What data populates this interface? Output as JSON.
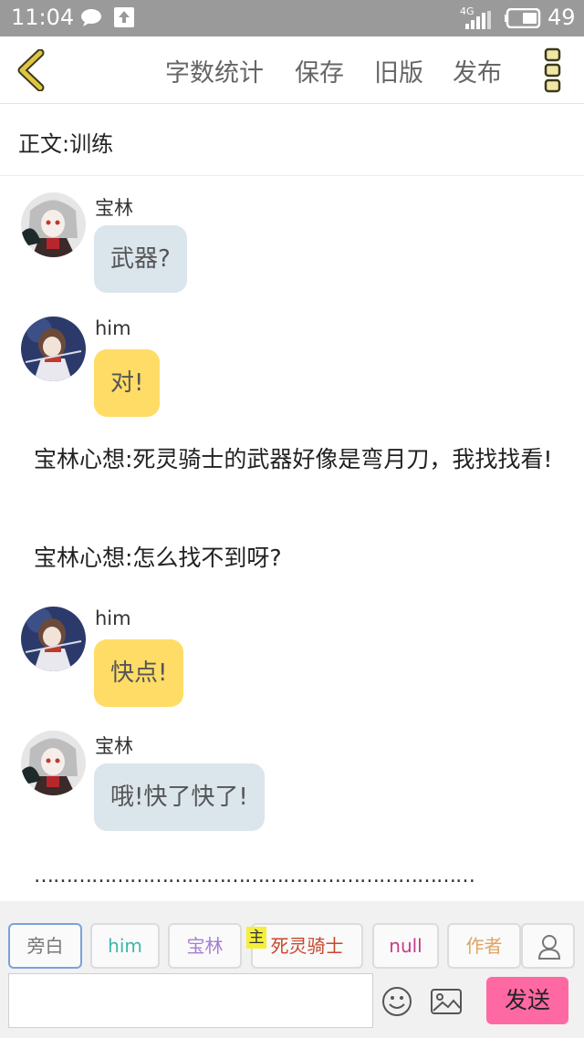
{
  "status_bar": {
    "time": "11:04",
    "network": "4G",
    "battery": "49",
    "icons": [
      "chat-icon",
      "upload-icon",
      "signal-icon",
      "battery-icon"
    ]
  },
  "toolbar": {
    "back_icon": "chevron-left-icon",
    "actions": [
      "字数统计",
      "保存",
      "旧版",
      "发布"
    ],
    "more_icon": "three-square-menu-icon",
    "accent": "#e0c542"
  },
  "title_row": {
    "text": "正文:训练"
  },
  "messages": [
    {
      "type": "dialog",
      "speaker": "宝林",
      "text": "武器?",
      "bubble_color": "#dbe5ec"
    },
    {
      "type": "dialog",
      "speaker": "him",
      "text": "对!",
      "bubble_color": "#ffdc66"
    },
    {
      "type": "narration",
      "text": "宝林心想:死灵骑士的武器好像是弯月刀，我找找看!"
    },
    {
      "type": "narration",
      "text": "宝林心想:怎么找不到呀?"
    },
    {
      "type": "dialog",
      "speaker": "him",
      "text": "快点!",
      "bubble_color": "#ffdc66"
    },
    {
      "type": "dialog",
      "speaker": "宝林",
      "text": "哦!快了快了!",
      "bubble_color": "#dbe5ec"
    }
  ],
  "ellipsis": "……………………………………………………………",
  "roles": [
    {
      "label": "旁白",
      "color": "#777777",
      "active": true
    },
    {
      "label": "him",
      "color": "#3bb8a8",
      "active": false
    },
    {
      "label": "宝林",
      "color": "#a57fd0",
      "active": false
    },
    {
      "label": "死灵骑士",
      "color": "#c8472c",
      "active": false
    },
    {
      "label": "null",
      "color": "#c83a86",
      "active": false
    },
    {
      "label": "作者",
      "color": "#e0a462",
      "active": false
    }
  ],
  "main_role_badge": "主",
  "input": {
    "placeholder": ""
  },
  "send_label": "发送",
  "send_color": "#ff69a3"
}
